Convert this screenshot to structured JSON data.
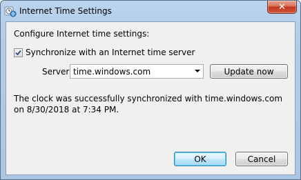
{
  "window": {
    "title": "Internet Time Settings",
    "close_label": "✕"
  },
  "content": {
    "heading": "Configure Internet time settings:",
    "sync_checkbox": {
      "label": "Synchronize with an Internet time server",
      "checked": true
    },
    "server_label": "Server:",
    "server_value": "time.windows.com",
    "update_button": "Update now",
    "message": "The clock was successfully synchronized with time.windows.com on 8/30/2018 at 7:34 PM."
  },
  "buttons": {
    "ok": "OK",
    "cancel": "Cancel"
  },
  "colors": {
    "titlebar": "#b3cde9",
    "client": "#f0f0f0",
    "close": "#c0361c",
    "default_button_border": "#3c7fb1"
  },
  "icons": {
    "app": "clock-globe-icon",
    "close": "close-icon",
    "check": "checkmark-icon",
    "dropdown": "chevron-down-icon"
  }
}
